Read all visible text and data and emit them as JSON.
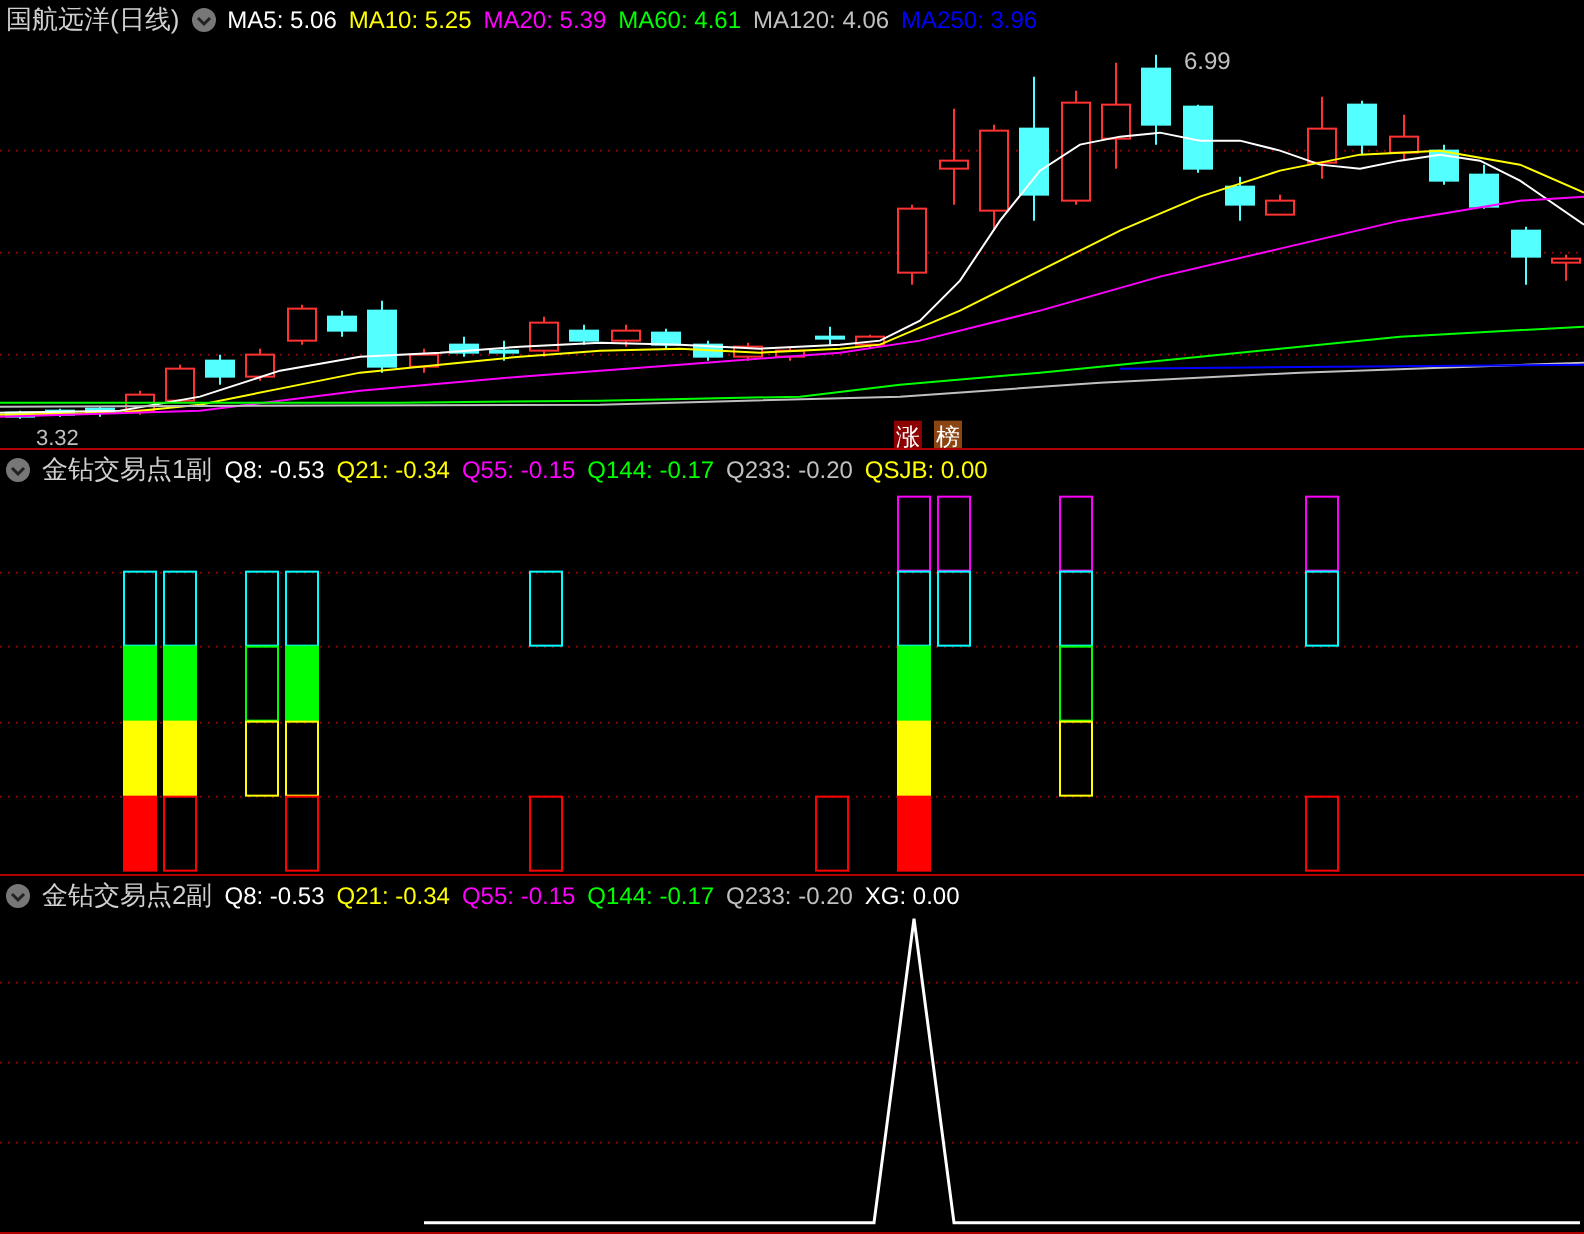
{
  "main_panel": {
    "title": "国航远洋(日线)",
    "indicators": [
      {
        "label": "MA5: 5.06",
        "color": "#ffffff"
      },
      {
        "label": "MA10: 5.25",
        "color": "#ffff00"
      },
      {
        "label": "MA20: 5.39",
        "color": "#ff00ff"
      },
      {
        "label": "MA60: 4.61",
        "color": "#00ff00"
      },
      {
        "label": "MA120: 4.06",
        "color": "#c0c0c0"
      },
      {
        "label": "MA250: 3.96",
        "color": "#0000ff"
      }
    ],
    "high_label": "6.99",
    "low_label": "3.32",
    "badges": [
      {
        "text": "涨",
        "color": "#8b0000"
      },
      {
        "text": "榜",
        "color": "#8b4513"
      }
    ]
  },
  "panel_1": {
    "title": "金钻交易点1副",
    "indicators": [
      {
        "label": "Q8: -0.53",
        "color": "#ffffff"
      },
      {
        "label": "Q21: -0.34",
        "color": "#ffff00"
      },
      {
        "label": "Q55: -0.15",
        "color": "#ff00ff"
      },
      {
        "label": "Q144: -0.17",
        "color": "#00ff00"
      },
      {
        "label": "Q233: -0.20",
        "color": "#c0c0c0"
      },
      {
        "label": "QSJB: 0.00",
        "color": "#ffff00"
      }
    ]
  },
  "panel_2": {
    "title": "金钻交易点2副",
    "indicators": [
      {
        "label": "Q8: -0.53",
        "color": "#ffffff"
      },
      {
        "label": "Q21: -0.34",
        "color": "#ffff00"
      },
      {
        "label": "Q55: -0.15",
        "color": "#ff00ff"
      },
      {
        "label": "Q144: -0.17",
        "color": "#00ff00"
      },
      {
        "label": "Q233: -0.20",
        "color": "#c0c0c0"
      },
      {
        "label": "XG: 0.00",
        "color": "#ffffff"
      }
    ]
  }
}
